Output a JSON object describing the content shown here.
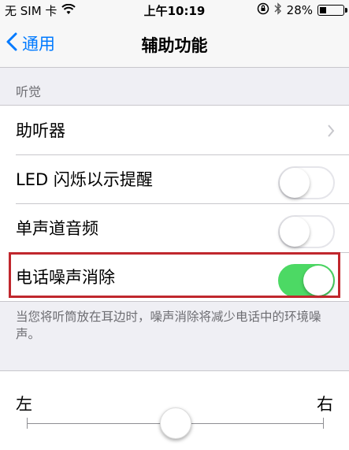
{
  "status_bar": {
    "carrier": "无 SIM 卡",
    "time": "上午10:19",
    "battery_percent": "28%",
    "battery_level": 0.28
  },
  "nav": {
    "back_label": "通用",
    "title": "辅助功能"
  },
  "section": {
    "header": "听觉"
  },
  "rows": [
    {
      "label": "助听器",
      "type": "disclosure"
    },
    {
      "label": "LED 闪烁以示提醒",
      "type": "switch",
      "on": false
    },
    {
      "label": "单声道音频",
      "type": "switch",
      "on": false
    },
    {
      "label": "电话噪声消除",
      "type": "switch",
      "on": true
    }
  ],
  "footer_note": "当您将听筒放在耳边时，噪声消除将减少电话中的环境噪声。",
  "balance": {
    "left_label": "左",
    "right_label": "右",
    "value": 0.5
  },
  "colors": {
    "accent": "#007aff",
    "switch_on": "#4cd964",
    "highlight": "#c0272d"
  },
  "icons": {
    "wifi": "wifi-icon",
    "lock_rotation": "rotation-lock-icon",
    "bluetooth": "bluetooth-icon",
    "battery": "battery-icon",
    "back": "chevron-left-icon",
    "disclosure": "chevron-right-icon"
  }
}
